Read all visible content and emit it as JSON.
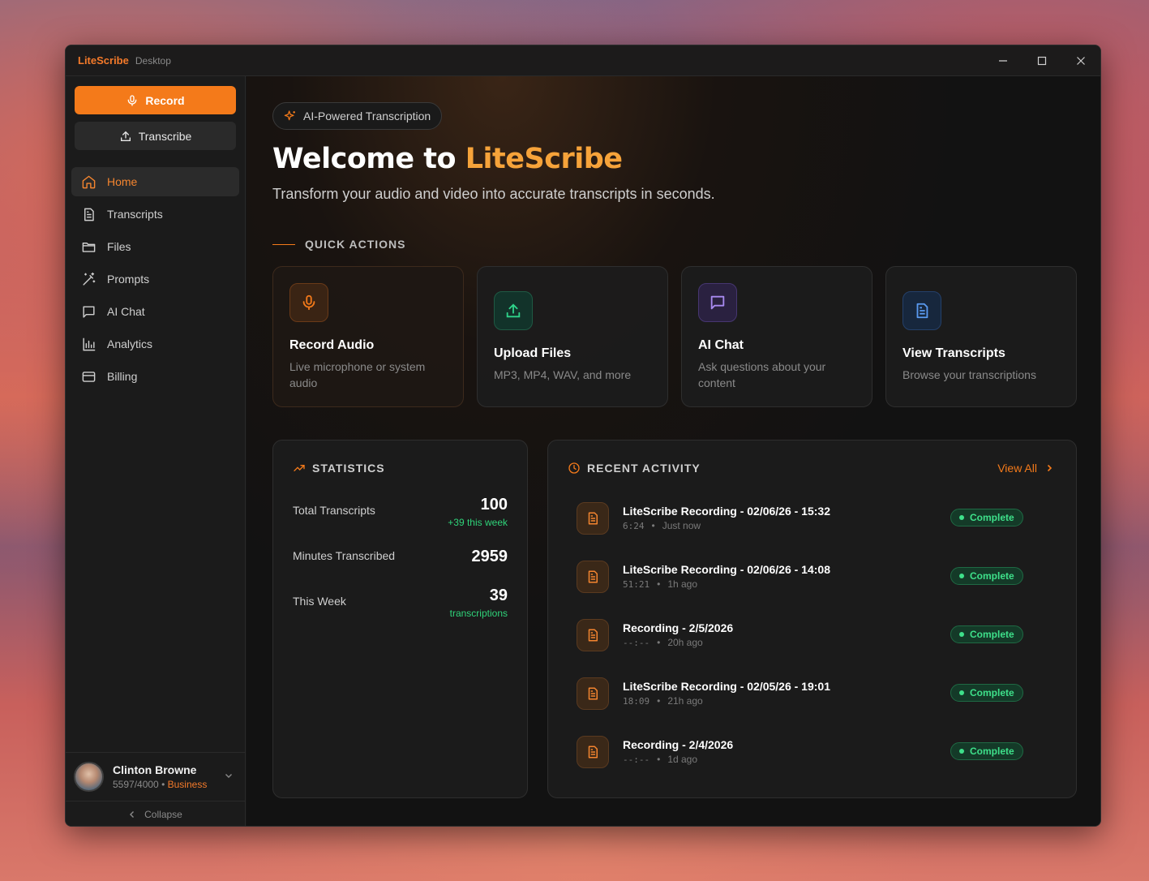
{
  "titlebar": {
    "app_name": "LiteScribe",
    "app_sub": "Desktop"
  },
  "sidebar": {
    "record_label": "Record",
    "transcribe_label": "Transcribe",
    "items": [
      {
        "label": "Home",
        "icon": "home-icon"
      },
      {
        "label": "Transcripts",
        "icon": "document-icon"
      },
      {
        "label": "Files",
        "icon": "folder-icon"
      },
      {
        "label": "Prompts",
        "icon": "wand-icon"
      },
      {
        "label": "AI Chat",
        "icon": "chat-icon"
      },
      {
        "label": "Analytics",
        "icon": "bar-chart-icon"
      },
      {
        "label": "Billing",
        "icon": "credit-card-icon"
      }
    ],
    "user": {
      "name": "Clinton Browne",
      "usage": "5597/4000",
      "separator": "•",
      "plan": "Business"
    },
    "collapse_label": "Collapse"
  },
  "hero": {
    "badge": "AI-Powered Transcription",
    "welcome_prefix": "Welcome to ",
    "welcome_brand": "LiteScribe",
    "subtitle": "Transform your audio and video into accurate transcripts in seconds."
  },
  "quick_actions": {
    "label": "QUICK ACTIONS",
    "cards": [
      {
        "title": "Record Audio",
        "desc": "Live microphone or system audio",
        "icon": "microphone-icon"
      },
      {
        "title": "Upload Files",
        "desc": "MP3, MP4, WAV, and more",
        "icon": "upload-icon"
      },
      {
        "title": "AI Chat",
        "desc": "Ask questions about your content",
        "icon": "chat-icon"
      },
      {
        "title": "View Transcripts",
        "desc": "Browse your transcriptions",
        "icon": "document-icon"
      }
    ]
  },
  "statistics": {
    "title": "STATISTICS",
    "rows": [
      {
        "label": "Total Transcripts",
        "value": "100",
        "sub": "+39 this week"
      },
      {
        "label": "Minutes Transcribed",
        "value": "2959",
        "sub": ""
      },
      {
        "label": "This Week",
        "value": "39",
        "sub": "transcriptions"
      }
    ]
  },
  "activity": {
    "title": "RECENT ACTIVITY",
    "view_all": "View All",
    "items": [
      {
        "title": "LiteScribe Recording - 02/06/26 - 15:32",
        "duration": "6:24",
        "sep": "•",
        "time": "Just now",
        "status": "Complete"
      },
      {
        "title": "LiteScribe Recording - 02/06/26 - 14:08",
        "duration": "51:21",
        "sep": "•",
        "time": "1h ago",
        "status": "Complete"
      },
      {
        "title": "Recording - 2/5/2026",
        "duration": "--:--",
        "sep": "•",
        "time": "20h ago",
        "status": "Complete"
      },
      {
        "title": "LiteScribe Recording - 02/05/26 - 19:01",
        "duration": "18:09",
        "sep": "•",
        "time": "21h ago",
        "status": "Complete"
      },
      {
        "title": "Recording - 2/4/2026",
        "duration": "--:--",
        "sep": "•",
        "time": "1d ago",
        "status": "Complete"
      }
    ]
  },
  "colors": {
    "accent": "#f47a1a",
    "brand_text": "#f6a33a",
    "success": "#3ee08a"
  }
}
